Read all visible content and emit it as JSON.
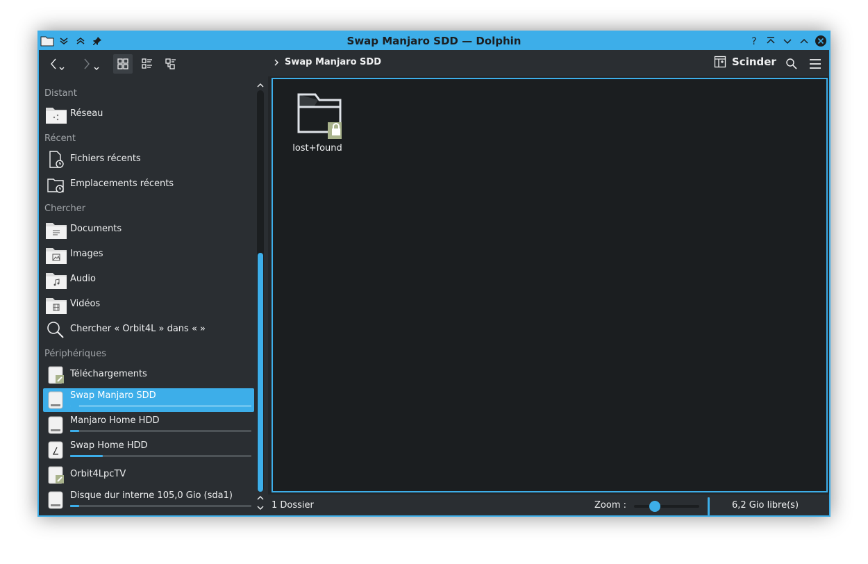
{
  "window": {
    "title": "Swap Manjaro SDD — Dolphin",
    "accent": "#3daee9",
    "background": "#232629"
  },
  "toolbar": {
    "breadcrumb": "Swap Manjaro SDD",
    "split_label": "Scinder"
  },
  "sidebar": {
    "sections": {
      "remote": "Distant",
      "recent": "Récent",
      "search": "Chercher",
      "devices": "Périphériques"
    },
    "remote_items": [
      {
        "label": "Réseau",
        "icon": "network-folder-icon"
      }
    ],
    "recent_items": [
      {
        "label": "Fichiers récents",
        "icon": "recent-files-icon"
      },
      {
        "label": "Emplacements récents",
        "icon": "recent-places-icon"
      }
    ],
    "search_items": [
      {
        "label": "Documents",
        "icon": "documents-folder-icon"
      },
      {
        "label": "Images",
        "icon": "images-folder-icon"
      },
      {
        "label": "Audio",
        "icon": "audio-folder-icon"
      },
      {
        "label": "Vidéos",
        "icon": "videos-folder-icon"
      },
      {
        "label": "Chercher « Orbit4L » dans «  »",
        "icon": "search-icon"
      }
    ],
    "device_items": [
      {
        "label": "Téléchargements",
        "icon": "network-drive-icon",
        "usage": null
      },
      {
        "label": "Swap Manjaro SDD",
        "icon": "drive-icon",
        "usage": 0.05,
        "selected": true
      },
      {
        "label": "Manjaro Home HDD",
        "icon": "drive-icon",
        "usage": 0.05
      },
      {
        "label": "Swap Home HDD",
        "icon": "root-drive-icon",
        "usage": 0.18
      },
      {
        "label": "Orbit4LpcTV",
        "icon": "network-drive-icon",
        "usage": null
      },
      {
        "label": "Disque dur interne 105,0 Gio (sda1)",
        "icon": "drive-icon",
        "usage": 0.05
      }
    ]
  },
  "content": {
    "items": [
      {
        "name": "lost+found",
        "icon": "locked-folder-icon"
      }
    ]
  },
  "statusbar": {
    "count": "1 Dossier",
    "zoom_label": "Zoom :",
    "zoom_level": 0.32,
    "free_space": "6,2 Gio libre(s)"
  }
}
